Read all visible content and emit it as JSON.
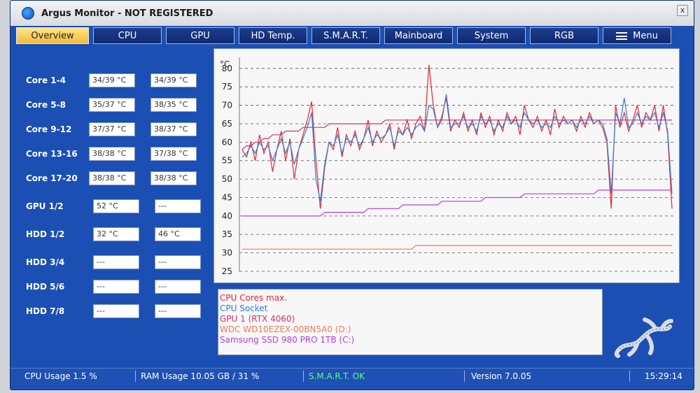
{
  "window": {
    "title": "Argus Monitor - NOT REGISTERED",
    "close_glyph": "x"
  },
  "tabs": [
    {
      "label": "Overview"
    },
    {
      "label": "CPU"
    },
    {
      "label": "GPU"
    },
    {
      "label": "HD Temp."
    },
    {
      "label": "S.M.A.R.T."
    },
    {
      "label": "Mainboard"
    },
    {
      "label": "System"
    },
    {
      "label": "RGB"
    },
    {
      "label": "Menu"
    }
  ],
  "active_tab": "Overview",
  "sensors": [
    {
      "label": "Core 1-4",
      "v1": "34/39 °C",
      "v2": "34/39 °C"
    },
    {
      "label": "Core 5-8",
      "v1": "35/37 °C",
      "v2": "38/35 °C"
    },
    {
      "label": "Core 9-12",
      "v1": "37/37 °C",
      "v2": "38/37 °C"
    },
    {
      "label": "Core 13-16",
      "v1": "38/38 °C",
      "v2": "37/38 °C"
    },
    {
      "label": "Core 17-20",
      "v1": "38/38 °C",
      "v2": "38/38 °C"
    },
    {
      "label": "GPU 1/2",
      "v1": "52 °C",
      "v2": "---"
    },
    {
      "label": "HDD 1/2",
      "v1": "32 °C",
      "v2": "46 °C"
    },
    {
      "label": "HDD 3/4",
      "v1": "---",
      "v2": "---"
    },
    {
      "label": "HDD 5/6",
      "v1": "---",
      "v2": "---"
    },
    {
      "label": "HDD 7/8",
      "v1": "---",
      "v2": "---"
    }
  ],
  "chart_data": {
    "type": "line",
    "ylabel": "°C",
    "ylim": [
      25,
      83
    ],
    "yticks": [
      80,
      75,
      70,
      65,
      60,
      55,
      50,
      45,
      40,
      35,
      30,
      25
    ],
    "series": [
      {
        "name": "CPU Cores max.",
        "color": "#e8232e",
        "values": [
          58,
          56,
          60,
          55,
          62,
          57,
          60,
          52,
          58,
          63,
          55,
          61,
          50,
          58,
          62,
          66,
          71,
          55,
          42,
          53,
          60,
          58,
          64,
          56,
          62,
          59,
          63,
          58,
          61,
          66,
          59,
          63,
          60,
          62,
          65,
          58,
          64,
          62,
          66,
          61,
          65,
          67,
          63,
          81,
          70,
          64,
          67,
          72,
          63,
          66,
          64,
          68,
          63,
          66,
          62,
          68,
          64,
          67,
          62,
          66,
          63,
          68,
          65,
          67,
          62,
          70,
          66,
          64,
          67,
          63,
          66,
          62,
          69,
          64,
          67,
          65,
          66,
          63,
          67,
          64,
          68,
          65,
          66,
          64,
          60,
          42,
          70,
          64,
          68,
          63,
          66,
          70,
          64,
          68,
          66,
          70,
          63,
          70,
          62,
          42
        ]
      },
      {
        "name": "CPU Socket",
        "color": "#2f7fd8",
        "values": [
          56,
          57,
          59,
          57,
          60,
          58,
          59,
          55,
          58,
          61,
          57,
          60,
          54,
          58,
          61,
          64,
          68,
          50,
          44,
          54,
          60,
          59,
          62,
          57,
          61,
          60,
          62,
          59,
          61,
          64,
          60,
          62,
          61,
          62,
          64,
          59,
          63,
          62,
          64,
          62,
          64,
          65,
          63,
          70,
          69,
          64,
          66,
          73,
          64,
          65,
          65,
          67,
          64,
          65,
          63,
          67,
          65,
          66,
          63,
          65,
          64,
          67,
          65,
          66,
          64,
          68,
          66,
          65,
          66,
          64,
          65,
          64,
          67,
          65,
          66,
          65,
          66,
          64,
          66,
          65,
          67,
          65,
          66,
          65,
          61,
          46,
          68,
          65,
          72,
          64,
          65,
          68,
          65,
          67,
          66,
          68,
          64,
          68,
          63,
          46
        ]
      },
      {
        "name": "GPU 1 (RTX 4060)",
        "color": "#d6306e",
        "values": [
          58,
          59,
          59,
          60,
          60,
          61,
          61,
          62,
          62,
          62,
          63,
          63,
          63,
          63,
          64,
          64,
          64,
          64,
          64,
          64,
          65,
          65,
          65,
          65,
          65,
          65,
          65,
          65,
          65,
          65,
          65,
          65,
          65,
          66,
          66,
          66,
          66,
          66,
          66,
          66,
          66,
          66,
          66,
          66,
          66,
          66,
          66,
          66,
          66,
          66,
          66,
          66,
          66,
          66,
          66,
          66,
          66,
          66,
          66,
          66,
          66,
          66,
          66,
          66,
          66,
          66,
          66,
          66,
          66,
          66,
          66,
          66,
          66,
          66,
          66,
          66,
          66,
          66,
          66,
          66,
          66,
          66,
          66,
          66,
          66,
          66,
          66,
          66,
          66,
          66,
          66,
          66,
          66,
          66,
          66,
          66,
          66,
          66,
          66,
          66
        ]
      },
      {
        "name": "WDC WD10EZEX-00BN5A0 (D:)",
        "color": "#ef7a5a",
        "values": [
          31,
          31,
          31,
          31,
          31,
          31,
          31,
          31,
          31,
          31,
          31,
          31,
          31,
          31,
          31,
          31,
          31,
          31,
          31,
          31,
          31,
          31,
          31,
          31,
          31,
          31,
          31,
          31,
          31,
          31,
          31,
          31,
          31,
          31,
          31,
          31,
          31,
          31,
          31,
          31,
          32,
          32,
          32,
          32,
          32,
          32,
          32,
          32,
          32,
          32,
          32,
          32,
          32,
          32,
          32,
          32,
          32,
          32,
          32,
          32,
          32,
          32,
          32,
          32,
          32,
          32,
          32,
          32,
          32,
          32,
          32,
          32,
          32,
          32,
          32,
          32,
          32,
          32,
          32,
          32,
          32,
          32,
          32,
          32,
          32,
          32,
          32,
          32,
          32,
          32,
          32,
          32,
          32,
          32,
          32,
          32,
          32,
          32,
          32,
          32
        ]
      },
      {
        "name": "Samsung SSD 980 PRO 1TB (C:)",
        "color": "#b03fe0",
        "values": [
          40,
          40,
          40,
          40,
          40,
          40,
          40,
          40,
          40,
          40,
          40,
          40,
          40,
          40,
          40,
          40,
          40,
          40,
          40,
          41,
          41,
          41,
          41,
          41,
          41,
          41,
          41,
          41,
          41,
          42,
          42,
          42,
          42,
          42,
          42,
          42,
          42,
          43,
          43,
          43,
          43,
          43,
          43,
          43,
          43,
          43,
          44,
          44,
          44,
          44,
          44,
          44,
          44,
          44,
          44,
          44,
          45,
          45,
          45,
          45,
          45,
          45,
          45,
          45,
          45,
          46,
          46,
          46,
          46,
          46,
          46,
          46,
          46,
          46,
          46,
          46,
          46,
          46,
          46,
          46,
          46,
          46,
          47,
          47,
          47,
          47,
          47,
          47,
          47,
          47,
          47,
          47,
          47,
          47,
          47,
          47,
          47,
          47,
          47,
          47
        ]
      }
    ]
  },
  "status": {
    "cpu_usage": "CPU Usage 1.5 %",
    "ram_usage": "RAM Usage 10.05 GB / 31 %",
    "smart": "S.M.A.R.T. OK",
    "version": "Version 7.0.05",
    "time": "15:29:14",
    "smart_color": "#5dff7a"
  }
}
